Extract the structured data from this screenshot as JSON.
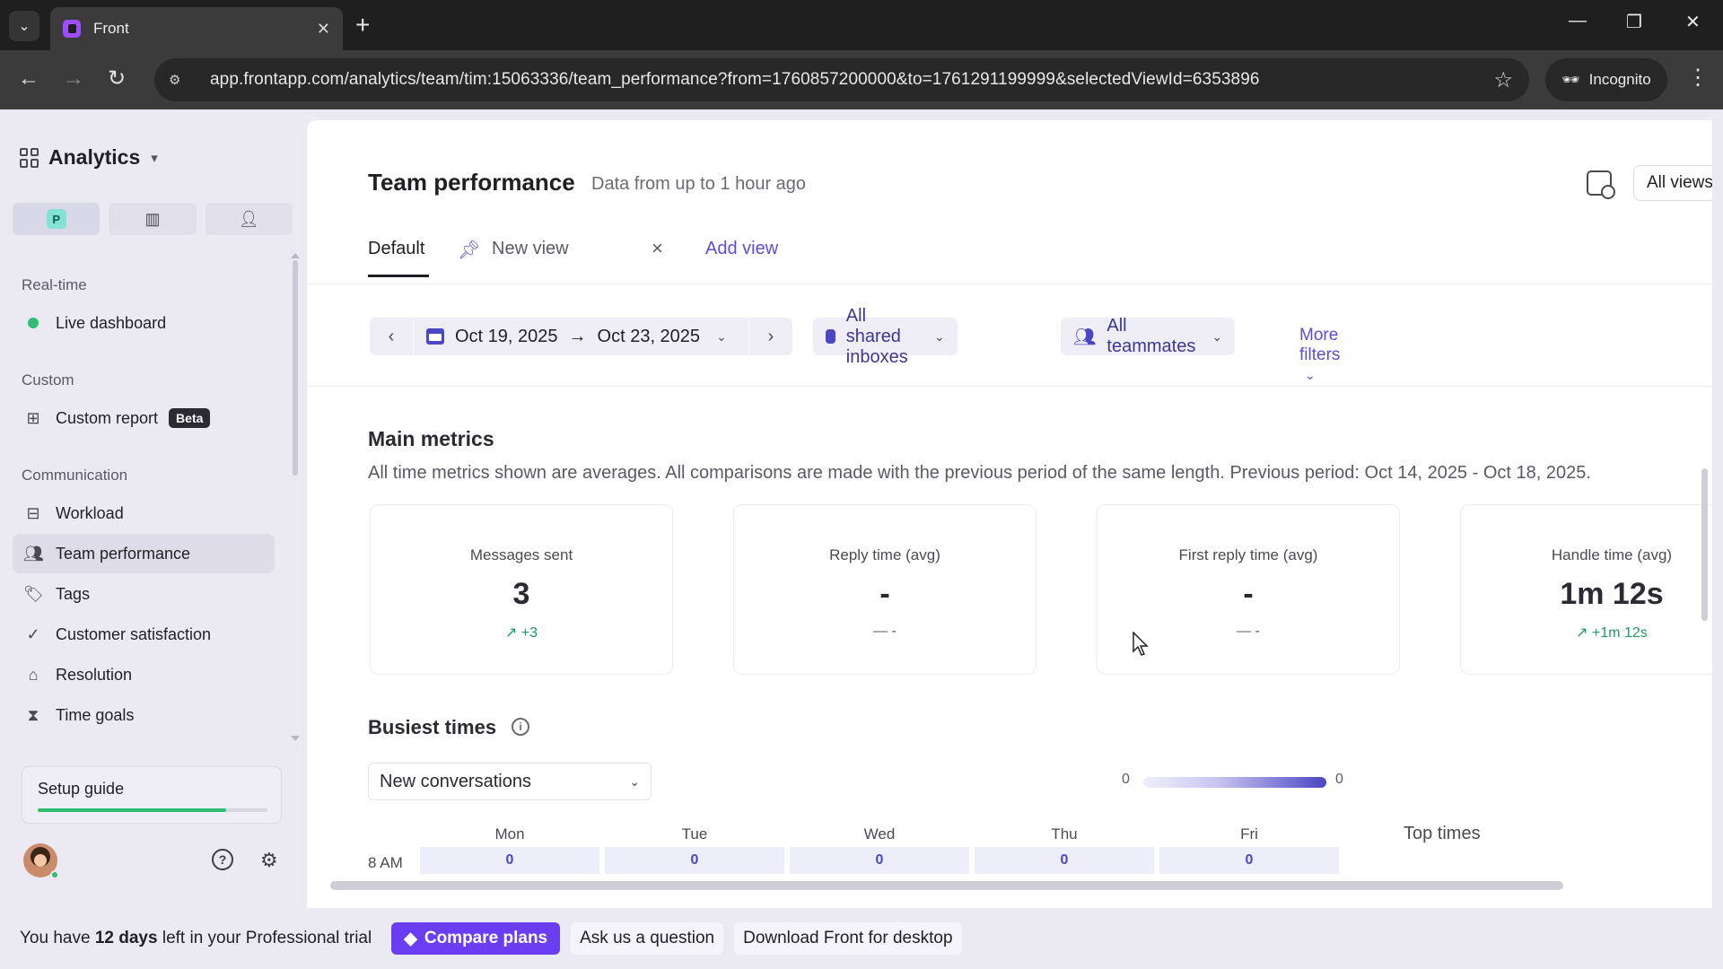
{
  "browser": {
    "tab_title": "Front",
    "url": "app.frontapp.com/analytics/team/tim:15063336/team_performance?from=1760857200000&to=1761291199999&selectedViewId=6353896",
    "incognito_label": "Incognito"
  },
  "sidebar": {
    "title": "Analytics",
    "workspace_avatar": "P",
    "sections": {
      "realtime": "Real-time",
      "custom": "Custom",
      "communication": "Communication"
    },
    "items": {
      "live_dashboard": "Live dashboard",
      "custom_report": "Custom report",
      "beta_badge": "Beta",
      "workload": "Workload",
      "team_performance": "Team performance",
      "tags": "Tags",
      "customer_satisfaction": "Customer satisfaction",
      "resolution": "Resolution",
      "time_goals": "Time goals"
    },
    "setup_guide": {
      "label": "Setup guide",
      "progress": 0.82
    }
  },
  "header": {
    "title": "Team performance",
    "subtitle": "Data from up to 1 hour ago",
    "all_views": "All views"
  },
  "view_tabs": {
    "default": "Default",
    "new_view": "New view",
    "add_view": "Add view"
  },
  "filters": {
    "date_from": "Oct 19, 2025",
    "date_arrow": "→",
    "date_to": "Oct 23, 2025",
    "inboxes": "All shared inboxes",
    "teammates": "All teammates",
    "more": "More filters"
  },
  "main_metrics": {
    "title": "Main metrics",
    "description": "All time metrics shown are averages. All comparisons are made with the previous period of the same length. Previous period: Oct 14, 2025 - Oct 18, 2025.",
    "cards": [
      {
        "label": "Messages sent",
        "value": "3",
        "delta": "↗ +3"
      },
      {
        "label": "Reply time (avg)",
        "value": "-",
        "delta": "— -"
      },
      {
        "label": "First reply time (avg)",
        "value": "-",
        "delta": "— -"
      },
      {
        "label": "Handle time (avg)",
        "value": "1m 12s",
        "delta": "↗ +1m 12s"
      }
    ]
  },
  "busiest_times": {
    "title": "Busiest times",
    "metric_select": "New conversations",
    "legend_min": "0",
    "legend_max": "0",
    "days": [
      "Mon",
      "Tue",
      "Wed",
      "Thu",
      "Fri"
    ],
    "top_times_label": "Top times",
    "rows": [
      {
        "hour": "8 AM",
        "values": [
          "0",
          "0",
          "0",
          "0",
          "0"
        ]
      }
    ]
  },
  "trial_bar": {
    "prefix": "You have",
    "days": "12 days",
    "suffix": "left in your Professional trial",
    "compare_plans": "Compare plans",
    "ask_question": "Ask us a question",
    "download": "Download Front for desktop"
  },
  "colors": {
    "accent": "#5b4fd6",
    "compare_button": "#6a3df0",
    "positive": "#1e9a5b",
    "live": "#2fbf71"
  }
}
